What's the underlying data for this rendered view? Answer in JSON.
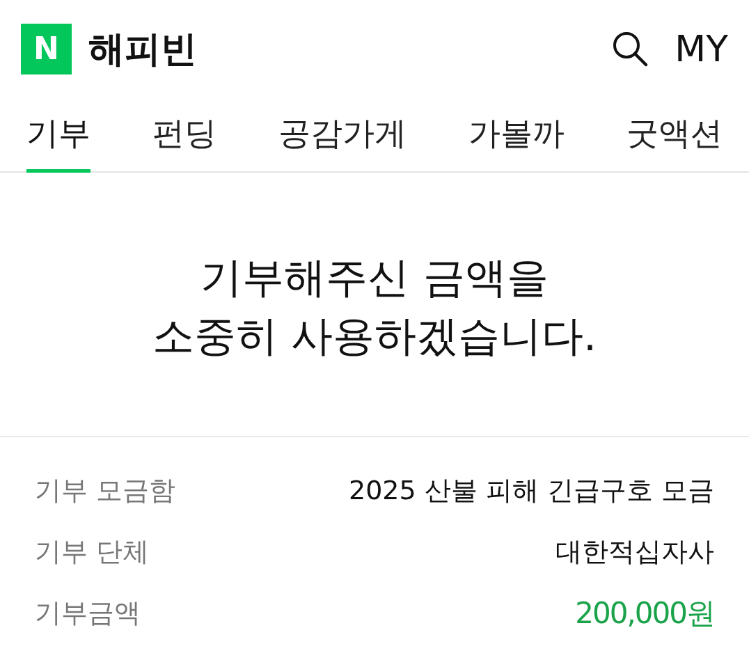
{
  "header": {
    "logo": "N",
    "title": "해피빈",
    "my": "MY"
  },
  "tabs": [
    {
      "label": "기부",
      "selected": true
    },
    {
      "label": "펀딩",
      "selected": false
    },
    {
      "label": "공감가게",
      "selected": false
    },
    {
      "label": "가볼까",
      "selected": false
    },
    {
      "label": "굿액션",
      "selected": false
    }
  ],
  "message": [
    "기부해주신 금액을",
    "소중히 사용하겠습니다."
  ],
  "details": [
    {
      "label": "기부 모금함",
      "value": "2025 산불 피해 긴급구호 모금",
      "kind": "text"
    },
    {
      "label": "기부 단체",
      "value": "대한적십자사",
      "kind": "text"
    },
    {
      "label": "기부금액",
      "value": "200,000원",
      "kind": "amount"
    }
  ]
}
